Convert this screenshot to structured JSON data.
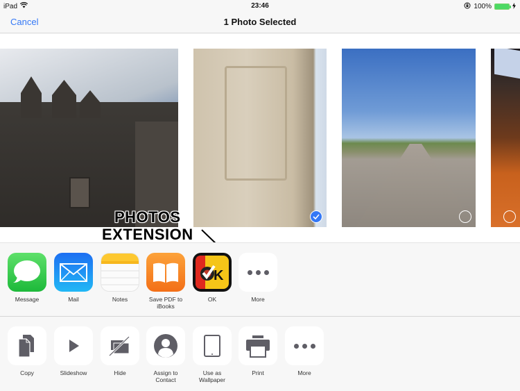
{
  "status_bar": {
    "device": "iPad",
    "time": "23:46",
    "battery_percent": "100%",
    "battery_level": 1.0,
    "icons": [
      "wifi-icon",
      "orientation-lock-icon",
      "battery-icon",
      "charging-icon"
    ]
  },
  "nav": {
    "cancel_label": "Cancel",
    "title": "1 Photo Selected"
  },
  "photos": [
    {
      "description": "Gothic cathedral facade",
      "selected": null
    },
    {
      "description": "Ornate stone tower",
      "selected": true
    },
    {
      "description": "Road under blue sky",
      "selected": false
    },
    {
      "description": "Indoor scene with screen",
      "selected": false
    }
  ],
  "annotation": {
    "line1": "PHOTOS",
    "line2": "EXTENSION"
  },
  "apps_row": [
    {
      "label": "Message",
      "icon": "message-icon"
    },
    {
      "label": "Mail",
      "icon": "mail-icon"
    },
    {
      "label": "Notes",
      "icon": "notes-icon"
    },
    {
      "label": "Save PDF to iBooks",
      "icon": "ibooks-icon"
    },
    {
      "label": "OK",
      "icon": "ok-app-icon"
    },
    {
      "label": "More",
      "icon": "more-icon"
    }
  ],
  "actions_row": [
    {
      "label": "Copy",
      "icon": "copy-icon"
    },
    {
      "label": "Slideshow",
      "icon": "play-icon"
    },
    {
      "label": "Hide",
      "icon": "hide-icon"
    },
    {
      "label": "Assign to Contact",
      "icon": "contact-icon"
    },
    {
      "label": "Use as Wallpaper",
      "icon": "ipad-icon"
    },
    {
      "label": "Print",
      "icon": "printer-icon"
    },
    {
      "label": "More",
      "icon": "more-icon"
    }
  ],
  "colors": {
    "accent": "#3478f6",
    "battery": "#4cd964",
    "action_glyph": "#5f5e66"
  }
}
